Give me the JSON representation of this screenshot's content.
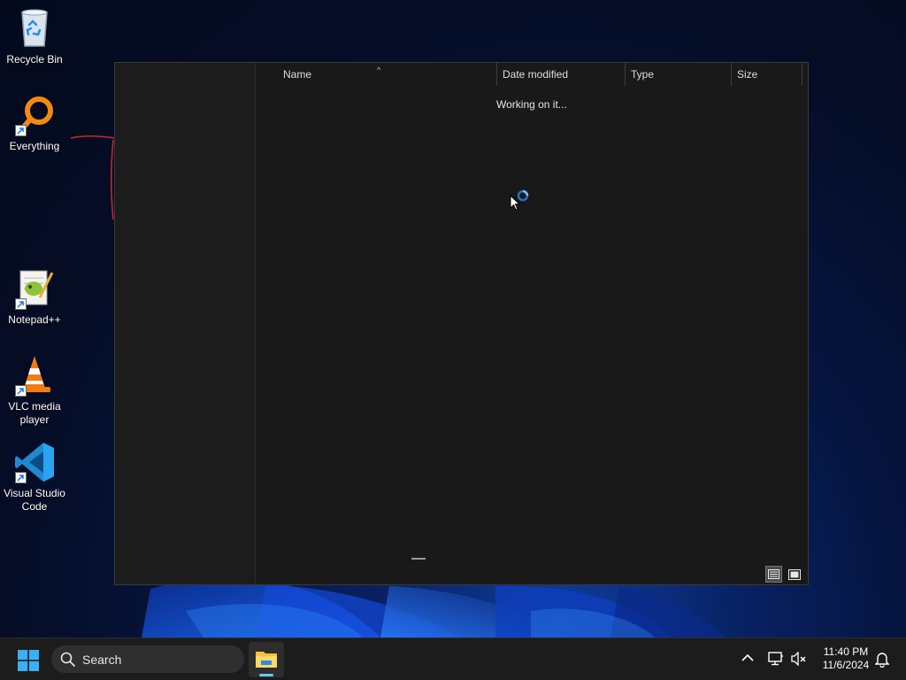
{
  "desktop": {
    "icons": [
      {
        "label": "Recycle Bin",
        "icon": "recycle-bin-icon"
      },
      {
        "label": "Everything",
        "icon": "everything-search-icon"
      },
      {
        "label": "Notepad++",
        "icon": "notepadpp-icon"
      },
      {
        "label": "VLC media player",
        "icon": "vlc-cone-icon"
      },
      {
        "label": "Visual Studio Code",
        "icon": "vscode-icon"
      }
    ]
  },
  "explorer": {
    "columns": [
      {
        "label": "Name"
      },
      {
        "label": "Date modified"
      },
      {
        "label": "Type"
      },
      {
        "label": "Size"
      }
    ],
    "sort_indicator": "^",
    "status_text": "Working on it...",
    "view_buttons": [
      "details-view-icon",
      "large-icons-view-icon"
    ],
    "active_view": "details"
  },
  "taskbar": {
    "search_placeholder": "Search",
    "pinned_apps": [
      {
        "name": "File Explorer",
        "icon": "file-explorer-icon",
        "active": true
      }
    ],
    "tray_icons": [
      "chevron-up-icon",
      "network-icon",
      "volume-muted-icon",
      "notification-bell-icon"
    ],
    "time": "11:40 PM",
    "date": "11/6/2024"
  },
  "colors": {
    "accent": "#60cdff",
    "window_bg": "#191919",
    "taskbar_bg": "#1c1c1c",
    "annotation_red": "#c0282d"
  }
}
